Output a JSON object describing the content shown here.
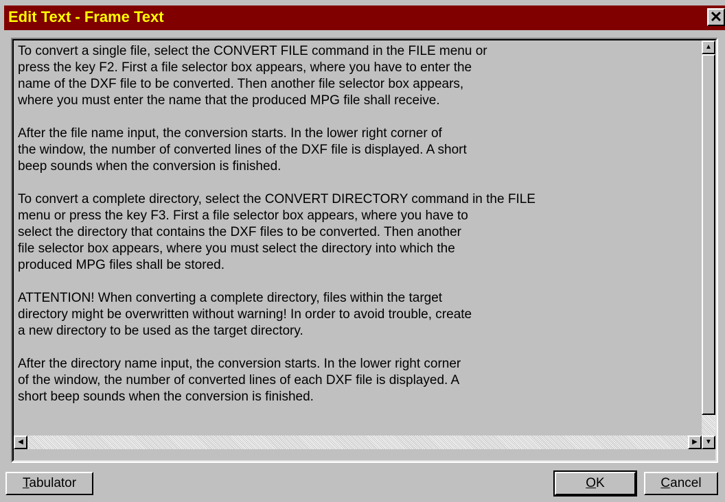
{
  "window": {
    "title": "Edit Text - Frame Text",
    "close_glyph": "✕",
    "colors": {
      "titlebar": "#800000",
      "title_text": "#ffff00",
      "face": "#c0c0c0"
    }
  },
  "editor": {
    "paragraphs": [
      {
        "lines": [
          "To convert a single file, select the CONVERT FILE command in the FILE menu or",
          "press the key F2. First a file selector box appears, where you have to enter the",
          "name of the DXF file to be converted. Then another file selector box appears,",
          "where you must enter the name that the produced MPG file shall receive."
        ]
      },
      {
        "lines": [
          "After the file name input, the conversion starts. In the lower right corner of",
          "the window, the number of converted lines of the DXF file is displayed. A short",
          "beep sounds when the conversion is finished."
        ]
      },
      {
        "lines": [
          "To convert a complete directory, select the CONVERT DIRECTORY command in the FILE",
          "menu or press the key F3. First a file selector box appears, where you have to",
          "select the directory that contains the DXF files to be converted. Then another",
          "file selector box appears, where you must select the directory into which the",
          "produced MPG files shall be stored."
        ]
      },
      {
        "lines": [
          "ATTENTION! When converting a complete directory, files within the target",
          "directory might be overwritten without warning! In order to avoid trouble, create",
          "a new directory to be used as the target directory."
        ]
      },
      {
        "lines": [
          "After the directory name input, the conversion starts. In the lower right corner",
          "of the window, the number of converted lines of each DXF file is displayed. A",
          "short beep sounds when the conversion is finished."
        ]
      }
    ],
    "vscroll": {
      "up_icon": "▲",
      "down_icon": "▼",
      "position_fraction": 0.0
    },
    "hscroll": {
      "left_icon": "◀",
      "right_icon": "▶"
    }
  },
  "buttons": {
    "tabulator": {
      "mnemonic": "T",
      "rest": "abulator"
    },
    "ok": {
      "mnemonic": "O",
      "rest": "K"
    },
    "cancel": {
      "mnemonic": "C",
      "rest": "ancel"
    }
  }
}
